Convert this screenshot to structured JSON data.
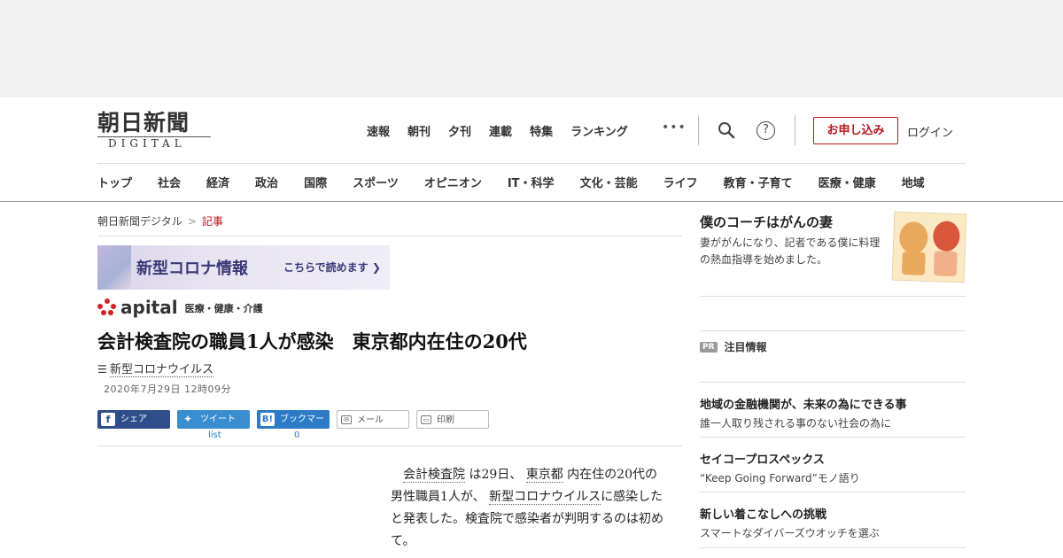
{
  "header": {
    "logo_ja": "朝日新聞",
    "logo_en": "DIGITAL",
    "top_nav": [
      "速報",
      "朝刊",
      "夕刊",
      "連載",
      "特集",
      "ランキング"
    ],
    "more": "•••",
    "apply_label": "お申し込み",
    "login_label": "ログイン"
  },
  "categories": [
    "トップ",
    "社会",
    "経済",
    "政治",
    "国際",
    "スポーツ",
    "オピニオン",
    "IT・科学",
    "文化・芸能",
    "ライフ",
    "教育・子育て",
    "医療・健康",
    "地域"
  ],
  "breadcrumb": {
    "home": "朝日新聞デジタル",
    "separator": ">",
    "current": "記事"
  },
  "corona_banner": {
    "title": "新型コロナ情報",
    "cta": "こちらで読めます ❯"
  },
  "apital": {
    "brand": "apital",
    "sub": "医療・健康・介護"
  },
  "article": {
    "headline": "会計検査院の職員1人が感染　東京都内在住の20代",
    "topic": "新型コロナウイルス",
    "date": "2020年7月29日 12時09分",
    "body_parts": [
      {
        "text": "会計検査院",
        "link": true
      },
      {
        "text": " は29日、 ",
        "link": false
      },
      {
        "text": "東京都",
        "link": true
      },
      {
        "text": " 内在住の20代の男性職員1人が、 ",
        "link": false
      },
      {
        "text": "新型コロナウイルス",
        "link": true
      },
      {
        "text": "に感染したと発表した。検査院で感染者が判明するのは初めて。",
        "link": false
      }
    ]
  },
  "share": {
    "facebook": "シェア",
    "twitter": "ツイート",
    "hatena": "ブックマーク",
    "mail": "メール",
    "print": "印刷",
    "twitter_count": "list",
    "hatena_count": "0"
  },
  "sidebar": {
    "coach_title": "僕のコーチはがんの妻",
    "coach_desc": "妻ががんになり、記者である僕に料理の熱血指導を始めました。",
    "pr_badge": "PR",
    "pr_label": "注目情報",
    "ads": [
      {
        "title": "地域の金融機関が、未来の為にできる事",
        "desc": "誰一人取り残される事のない社会の為に"
      },
      {
        "title": "セイコープロスペックス",
        "desc": "“Keep Going Forward”モノ語り"
      },
      {
        "title": "新しい着こなしへの挑戦",
        "desc": "スマートなダイバーズウオッチを選ぶ"
      }
    ]
  },
  "colors": {
    "brand_red": "#b8161e",
    "facebook": "#2e4d8a",
    "twitter": "#3a8ed0",
    "hatena": "#2b7bc7"
  }
}
